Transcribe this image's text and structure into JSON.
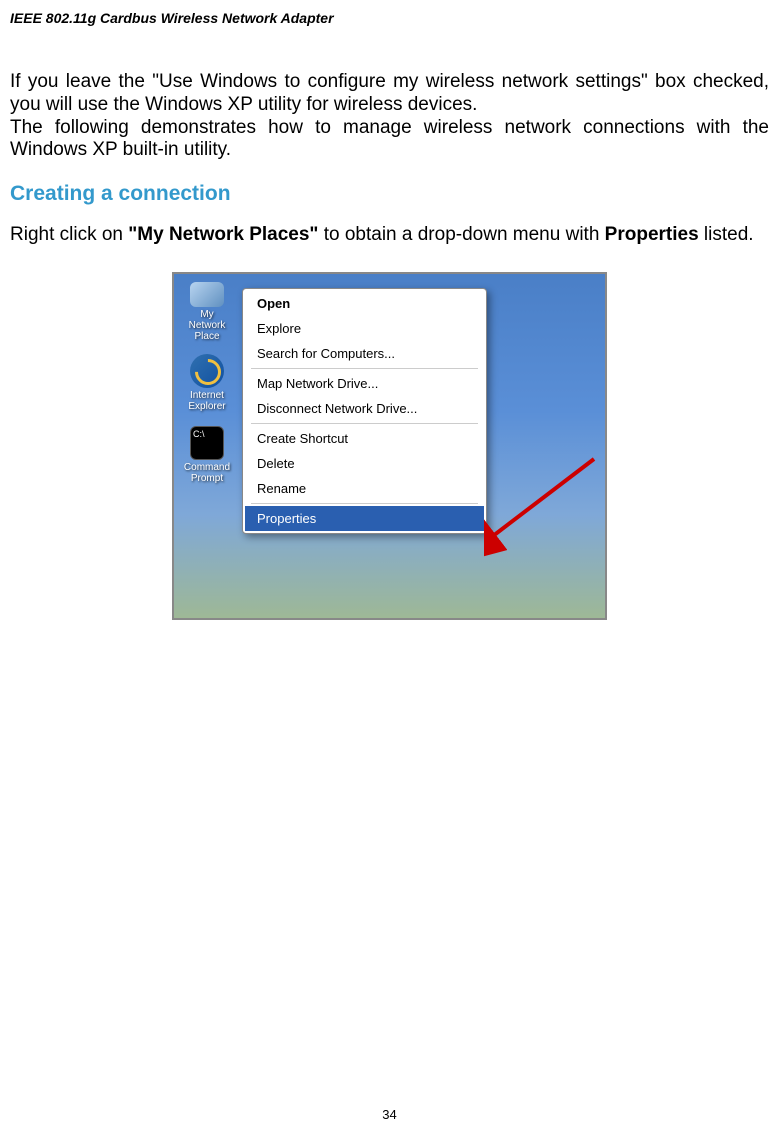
{
  "header": {
    "title": "IEEE 802.11g Cardbus Wireless Network Adapter"
  },
  "intro": {
    "line1": "If you leave the \"Use Windows to configure my wireless network settings\" box checked, you will use the Windows XP utility for wireless devices.",
    "line2": "The following demonstrates how to manage wireless network connections with the Windows XP built-in utility."
  },
  "section": {
    "heading": "Creating a connection"
  },
  "instruction": {
    "prefix": "Right click on ",
    "bold1": "\"My Network Places\"",
    "middle": " to obtain a drop-down menu with ",
    "bold2": "Properties",
    "suffix": " listed."
  },
  "desktop_icons": {
    "network": "My Network Place",
    "ie": "Internet Explorer",
    "cmd": "Command Prompt"
  },
  "context_menu": {
    "items": [
      {
        "label": "Open",
        "bold": true,
        "selected": false
      },
      {
        "label": "Explore",
        "bold": false,
        "selected": false
      },
      {
        "label": "Search for Computers...",
        "bold": false,
        "selected": false
      },
      {
        "separator": true
      },
      {
        "label": "Map Network Drive...",
        "bold": false,
        "selected": false
      },
      {
        "label": "Disconnect Network Drive...",
        "bold": false,
        "selected": false
      },
      {
        "separator": true
      },
      {
        "label": "Create Shortcut",
        "bold": false,
        "selected": false
      },
      {
        "label": "Delete",
        "bold": false,
        "selected": false
      },
      {
        "label": "Rename",
        "bold": false,
        "selected": false
      },
      {
        "separator": true
      },
      {
        "label": "Properties",
        "bold": false,
        "selected": true
      }
    ]
  },
  "page_number": "34"
}
